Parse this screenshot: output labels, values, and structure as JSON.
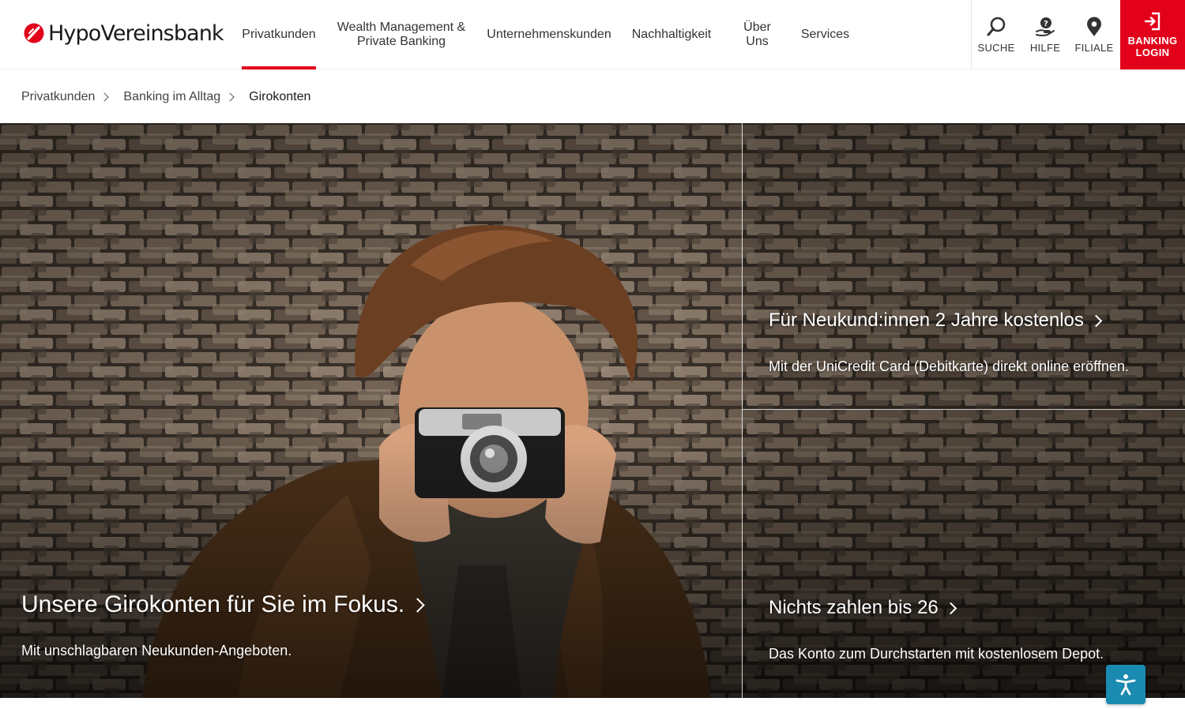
{
  "brand": {
    "name": "HypoVereinsbank",
    "accent": "#e2001a"
  },
  "nav": {
    "items": [
      {
        "label": "Privatkunden",
        "active": true
      },
      {
        "label": "Wealth Management &\nPrivate Banking",
        "active": false
      },
      {
        "label": "Unternehmenskunden",
        "active": false
      },
      {
        "label": "Nachhaltigkeit",
        "active": false
      },
      {
        "label": "Über Uns",
        "active": false
      },
      {
        "label": "Services",
        "active": false
      }
    ]
  },
  "tools": {
    "search": {
      "label": "SUCHE",
      "icon": "search-icon"
    },
    "help": {
      "label": "HILFE",
      "icon": "help-icon"
    },
    "branch": {
      "label": "FILIALE",
      "icon": "location-pin-icon"
    },
    "login": {
      "label": "BANKING\nLOGIN",
      "icon": "login-icon"
    }
  },
  "breadcrumb": {
    "items": [
      "Privatkunden",
      "Banking im Alltag",
      "Girokonten"
    ]
  },
  "hero": {
    "main": {
      "title": "Unsere Girokonten für Sie im Fokus.",
      "subtitle": "Mit unschlagbaren Neukunden-Angeboten."
    },
    "top_right": {
      "title": "Für Neukund:innen 2 Jahre kostenlos",
      "subtitle": "Mit der UniCredit Card (Debitkarte) direkt online eröffnen."
    },
    "bottom_right": {
      "title": "Nichts zahlen bis 26",
      "subtitle": "Das Konto zum Durchstarten mit kostenlosem Depot."
    }
  },
  "accessibility": {
    "icon": "accessibility-icon",
    "color": "#1a8bb0"
  }
}
